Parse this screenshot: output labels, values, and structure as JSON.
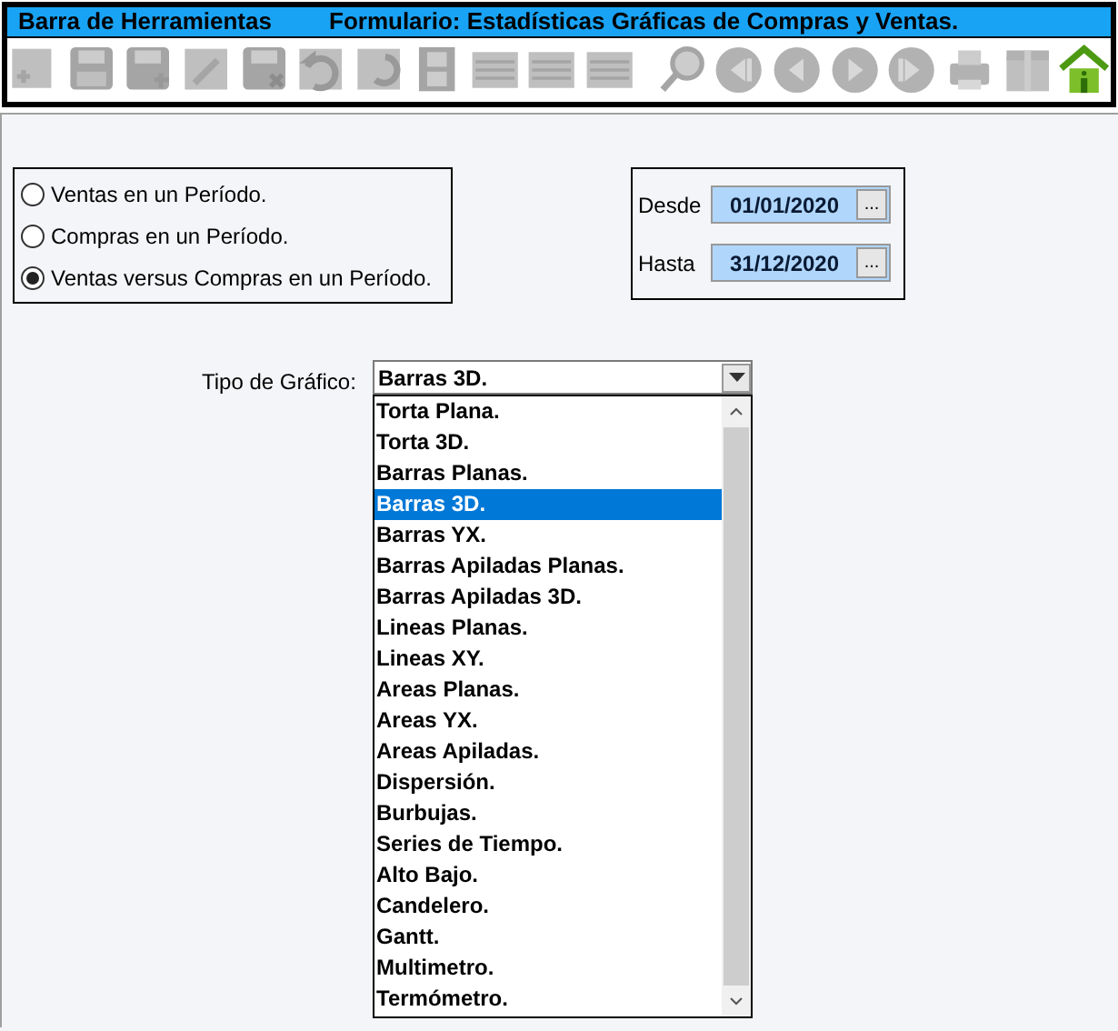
{
  "title_bar": {
    "toolbar_title": "Barra de Herramientas",
    "form_title": "Formulario: Estadísticas Gráficas de Compras y Ventas."
  },
  "toolbar": [
    {
      "kind": "add",
      "disabled": true
    },
    {
      "kind": "save",
      "disabled": true
    },
    {
      "kind": "save-as",
      "disabled": true
    },
    {
      "kind": "edit",
      "disabled": true
    },
    {
      "kind": "delete",
      "disabled": true
    },
    {
      "kind": "undo",
      "disabled": true
    },
    {
      "kind": "redo",
      "disabled": true
    },
    {
      "kind": "film",
      "disabled": true
    },
    {
      "kind": "list",
      "disabled": true
    },
    {
      "kind": "list",
      "disabled": true
    },
    {
      "kind": "list",
      "disabled": true
    },
    {
      "kind": "search",
      "disabled": true
    },
    {
      "kind": "first",
      "disabled": true
    },
    {
      "kind": "prev",
      "disabled": true
    },
    {
      "kind": "next",
      "disabled": true
    },
    {
      "kind": "last",
      "disabled": true
    },
    {
      "kind": "print",
      "disabled": true
    },
    {
      "kind": "box",
      "disabled": true
    },
    {
      "kind": "home",
      "disabled": false
    }
  ],
  "report_type": [
    {
      "label": "Ventas en un Período.",
      "selected": false
    },
    {
      "label": "Compras en un Período.",
      "selected": false
    },
    {
      "label": "Ventas versus Compras en un Período.",
      "selected": true
    }
  ],
  "dates": [
    {
      "label": "Desde",
      "value": "01/01/2020",
      "button": "..."
    },
    {
      "label": "Hasta",
      "value": "31/12/2020",
      "button": "..."
    }
  ],
  "chart_type": {
    "label": "Tipo de Gráfico:",
    "value": "Barras 3D.",
    "expanded": true,
    "options": [
      {
        "label": "Torta Plana.",
        "selected": false
      },
      {
        "label": "Torta 3D.",
        "selected": false
      },
      {
        "label": "Barras Planas.",
        "selected": false
      },
      {
        "label": "Barras 3D.",
        "selected": true
      },
      {
        "label": "Barras YX.",
        "selected": false
      },
      {
        "label": "Barras Apiladas Planas.",
        "selected": false
      },
      {
        "label": "Barras Apiladas 3D.",
        "selected": false
      },
      {
        "label": "Lineas Planas.",
        "selected": false
      },
      {
        "label": "Lineas XY.",
        "selected": false
      },
      {
        "label": "Areas Planas.",
        "selected": false
      },
      {
        "label": "Areas YX.",
        "selected": false
      },
      {
        "label": "Areas Apiladas.",
        "selected": false
      },
      {
        "label": "Dispersión.",
        "selected": false
      },
      {
        "label": "Burbujas.",
        "selected": false
      },
      {
        "label": "Series de Tiempo.",
        "selected": false
      },
      {
        "label": "Alto Bajo.",
        "selected": false
      },
      {
        "label": "Candelero.",
        "selected": false
      },
      {
        "label": "Gantt.",
        "selected": false
      },
      {
        "label": "Multimetro.",
        "selected": false
      },
      {
        "label": "Termómetro.",
        "selected": false
      }
    ]
  }
}
